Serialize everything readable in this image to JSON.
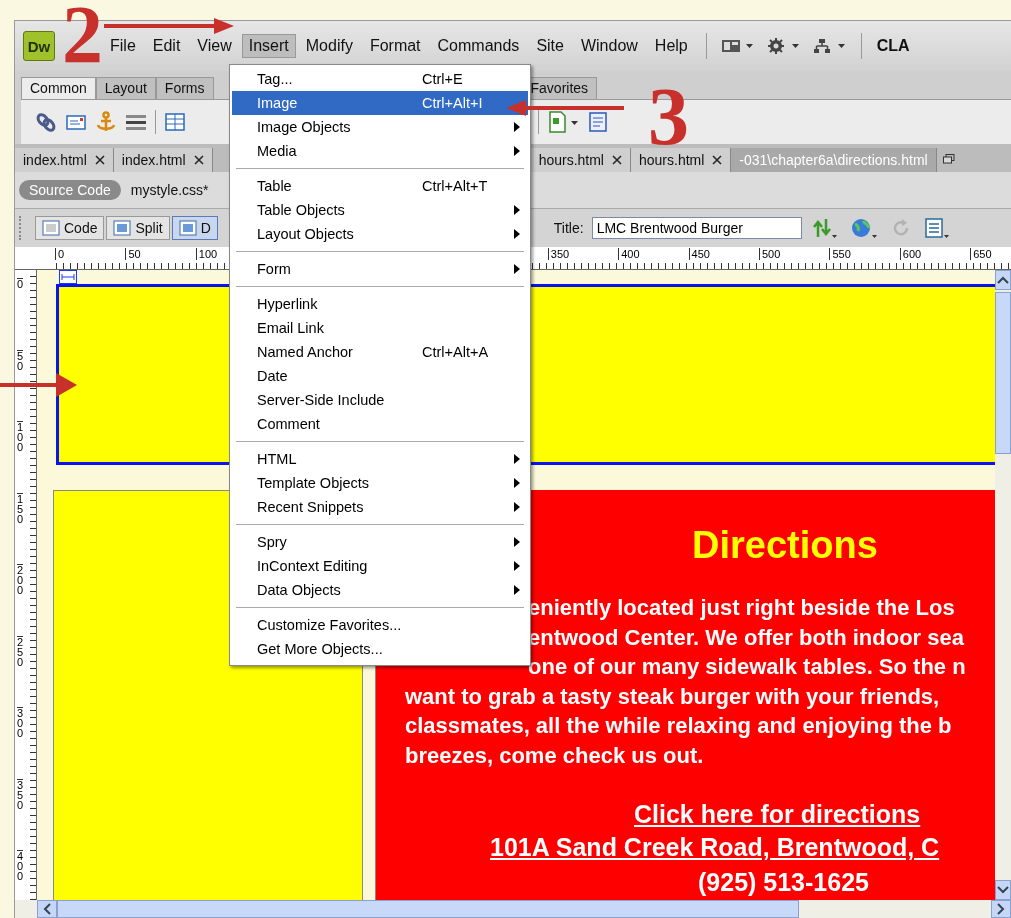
{
  "annotations": [
    {
      "label": "2"
    },
    {
      "label": "3"
    }
  ],
  "menubar": {
    "logo": "Dw",
    "items": [
      {
        "label": "File",
        "selected": false
      },
      {
        "label": "Edit",
        "selected": false
      },
      {
        "label": "View",
        "selected": false
      },
      {
        "label": "Insert",
        "selected": true
      },
      {
        "label": "Modify",
        "selected": false
      },
      {
        "label": "Format",
        "selected": false
      },
      {
        "label": "Commands",
        "selected": false
      },
      {
        "label": "Site",
        "selected": false
      },
      {
        "label": "Window",
        "selected": false
      },
      {
        "label": "Help",
        "selected": false
      }
    ],
    "workspace": "CLA"
  },
  "insert_bar": {
    "tabs": [
      {
        "label": "Common",
        "selected": true
      },
      {
        "label": "Layout",
        "selected": false
      },
      {
        "label": "Forms",
        "selected": false
      },
      {
        "label": "Favorites",
        "selected": false
      }
    ]
  },
  "document_tabs": [
    {
      "label": "index.html",
      "selected": false
    },
    {
      "label": "index.html",
      "selected": false
    },
    {
      "label": "hours.html",
      "selected": false
    },
    {
      "label": "hours.html",
      "selected": false
    },
    {
      "label": "-031\\chapter6a\\directions.html",
      "selected": true
    }
  ],
  "related_files": {
    "source": "Source Code",
    "files": [
      "mystyle.css*"
    ]
  },
  "doc_toolbar": {
    "views": [
      {
        "label": "Code",
        "selected": false
      },
      {
        "label": "Split",
        "selected": false
      },
      {
        "label": "D",
        "selected": true
      }
    ],
    "title_label": "Title:",
    "title_value": "LMC Brentwood Burger"
  },
  "rulers": {
    "horizontal": [
      "0",
      "50",
      "100",
      "350",
      "400",
      "450",
      "500",
      "550",
      "600",
      "650"
    ],
    "vertical": [
      "0",
      "50",
      "100",
      "150",
      "200",
      "250",
      "300",
      "350",
      "400"
    ]
  },
  "page": {
    "heading": "Directions",
    "lines": [
      {
        "text": "eniently located just right beside the Los",
        "kind": "covered"
      },
      {
        "text": "entwood Center. We offer both indoor sea",
        "kind": "covered"
      },
      {
        "text": "one of our many sidewalk tables. So the n",
        "kind": "covered"
      },
      {
        "text": "want to grab a tasty steak burger with your friends,",
        "kind": "full"
      },
      {
        "text": "classmates, all the while relaxing and enjoying the b",
        "kind": "full"
      },
      {
        "text": "breezes, come check us out.",
        "kind": "full"
      }
    ],
    "link": "Click here for directions",
    "address": "101A Sand Creek Road, Brentwood, C",
    "phone": "(925) 513-1625"
  },
  "insert_menu": {
    "groups": [
      [
        {
          "label": "Tag...",
          "shortcut": "Ctrl+E",
          "submenu": false,
          "selected": false
        },
        {
          "label": "Image",
          "shortcut": "Ctrl+Alt+I",
          "submenu": false,
          "selected": true
        },
        {
          "label": "Image Objects",
          "submenu": true,
          "selected": false
        },
        {
          "label": "Media",
          "submenu": true,
          "selected": false
        }
      ],
      [
        {
          "label": "Table",
          "shortcut": "Ctrl+Alt+T",
          "submenu": false,
          "selected": false
        },
        {
          "label": "Table Objects",
          "submenu": true,
          "selected": false
        },
        {
          "label": "Layout Objects",
          "submenu": true,
          "selected": false
        }
      ],
      [
        {
          "label": "Form",
          "submenu": true,
          "selected": false
        }
      ],
      [
        {
          "label": "Hyperlink",
          "submenu": false,
          "selected": false
        },
        {
          "label": "Email Link",
          "submenu": false,
          "selected": false
        },
        {
          "label": "Named Anchor",
          "shortcut": "Ctrl+Alt+A",
          "submenu": false,
          "selected": false
        },
        {
          "label": "Date",
          "submenu": false,
          "selected": false
        },
        {
          "label": "Server-Side Include",
          "submenu": false,
          "selected": false
        },
        {
          "label": "Comment",
          "submenu": false,
          "selected": false
        }
      ],
      [
        {
          "label": "HTML",
          "submenu": true,
          "selected": false
        },
        {
          "label": "Template Objects",
          "submenu": true,
          "selected": false
        },
        {
          "label": "Recent Snippets",
          "submenu": true,
          "selected": false
        }
      ],
      [
        {
          "label": "Spry",
          "submenu": true,
          "selected": false
        },
        {
          "label": "InContext Editing",
          "submenu": true,
          "selected": false
        },
        {
          "label": "Data Objects",
          "submenu": true,
          "selected": false
        }
      ],
      [
        {
          "label": "Customize Favorites...",
          "submenu": false,
          "selected": false
        },
        {
          "label": "Get More Objects...",
          "submenu": false,
          "selected": false
        }
      ]
    ]
  }
}
